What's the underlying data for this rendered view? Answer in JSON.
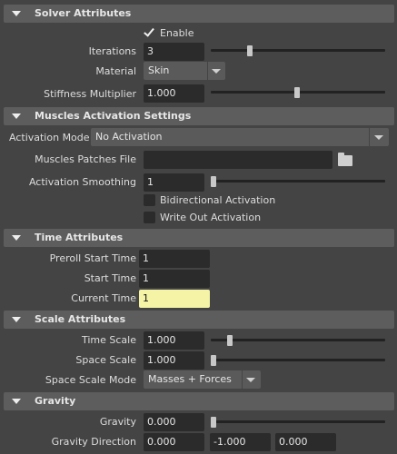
{
  "solver": {
    "title": "Solver Attributes",
    "enable_label": "Enable",
    "enable_checked": true,
    "iterations_label": "Iterations",
    "iterations_value": "3",
    "material_label": "Material",
    "material_value": "Skin",
    "stiffness_label": "Stiffness Multiplier",
    "stiffness_value": "1.000"
  },
  "muscles": {
    "title": "Muscles Activation Settings",
    "activation_mode_label": "Activation Mode",
    "activation_mode_value": "No Activation",
    "patches_label": "Muscles Patches File",
    "patches_value": "",
    "smoothing_label": "Activation Smoothing",
    "smoothing_value": "1",
    "bidirectional_label": "Bidirectional Activation",
    "bidirectional_checked": false,
    "writeout_label": "Write Out Activation",
    "writeout_checked": false
  },
  "time": {
    "title": "Time Attributes",
    "preroll_label": "Preroll Start Time",
    "preroll_value": "1",
    "start_label": "Start Time",
    "start_value": "1",
    "current_label": "Current Time",
    "current_value": "1",
    "current_highlight": "#f4f3a6"
  },
  "scale": {
    "title": "Scale Attributes",
    "time_scale_label": "Time Scale",
    "time_scale_value": "1.000",
    "space_scale_label": "Space Scale",
    "space_scale_value": "1.000",
    "space_mode_label": "Space Scale Mode",
    "space_mode_value": "Masses + Forces"
  },
  "gravity": {
    "title": "Gravity",
    "gravity_label": "Gravity",
    "gravity_value": "0.000",
    "direction_label": "Gravity Direction",
    "direction_x": "0.000",
    "direction_y": "-1.000",
    "direction_z": "0.000"
  },
  "icons": {
    "section_toggle": "triangle-down-icon",
    "browse": "folder-icon"
  }
}
